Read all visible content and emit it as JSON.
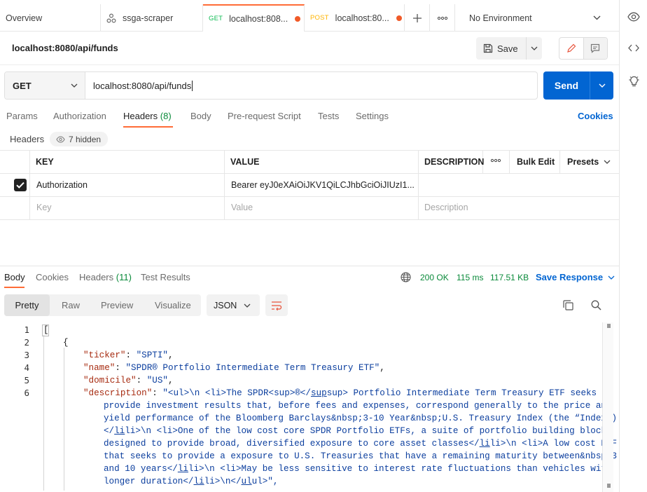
{
  "tabs": [
    {
      "label": "Overview"
    },
    {
      "label": "ssga-scraper",
      "icon": "collection-icon"
    },
    {
      "method": "GET",
      "label": "localhost:808...",
      "unsaved": true
    },
    {
      "method": "POST",
      "label": "localhost:80...",
      "unsaved": true
    }
  ],
  "environment": {
    "label": "No Environment"
  },
  "request": {
    "title": "localhost:8080/api/funds",
    "save_label": "Save",
    "method": "GET",
    "url": "localhost:8080/api/funds",
    "send_label": "Send"
  },
  "request_tabs": {
    "params": "Params",
    "authorization": "Authorization",
    "headers": "Headers",
    "headers_count": "(8)",
    "body": "Body",
    "prerequest": "Pre-request Script",
    "tests": "Tests",
    "settings": "Settings",
    "cookies": "Cookies"
  },
  "headers_section": {
    "label": "Headers",
    "hidden": "7 hidden"
  },
  "headers_table": {
    "col_key": "KEY",
    "col_value": "VALUE",
    "col_description": "DESCRIPTION",
    "bulk_edit": "Bulk Edit",
    "presets": "Presets",
    "rows": [
      {
        "key": "Authorization",
        "value": "Bearer eyJ0eXAiOiJKV1QiLCJhbGciOiJIUzI1...",
        "checked": true
      }
    ],
    "placeholder": {
      "key": "Key",
      "value": "Value",
      "description": "Description"
    }
  },
  "response_tabs": {
    "body": "Body",
    "cookies": "Cookies",
    "headers": "Headers",
    "headers_count": "(11)",
    "test_results": "Test Results"
  },
  "response_meta": {
    "status": "200 OK",
    "time": "115 ms",
    "size": "117.51 KB",
    "save_response": "Save Response"
  },
  "view_modes": {
    "pretty": "Pretty",
    "raw": "Raw",
    "preview": "Preview",
    "visualize": "Visualize",
    "format": "JSON"
  },
  "code": {
    "line_numbers": [
      "1",
      "2",
      "3",
      "4",
      "5",
      "6"
    ],
    "l1": "[",
    "l2": "{",
    "ticker_key": "\"ticker\"",
    "ticker_val": "\"SPTI\"",
    "name_key": "\"name\"",
    "name_val": "\"SPDR® Portfolio Intermediate Term Treasury ETF\"",
    "domicile_key": "\"domicile\"",
    "domicile_val": "\"US\"",
    "desc_key": "\"description\"",
    "desc_lines": [
      "\"<ul>\\n <li>The SPDR<sup>®</",
      "provide investment results that, before fees and expenses, correspond generally to the price and",
      "yield performance of the Bloomberg Barclays&nbsp;3-10 Year&nbsp;U.S. Treasury Index (the “Index”)",
      "</",
      "designed to provide broad, diversified exposure to core asset classes</",
      "that seeks to provide a exposure to U.S. Treasuries that have a remaining maturity between&nbsp;3",
      "and 10 years</",
      "longer duration</"
    ],
    "desc_tail": [
      "sup> Portfolio Intermediate Term Treasury ETF seeks to",
      "li>\\n <li>One of the low cost core SPDR Portfolio ETFs, a suite of portfolio building blocks",
      "li>\\n <li>A low cost ETF",
      "li>\\n <li>May be less sensitive to interest rate fluctuations than vehicles with",
      "li>\\n</",
      "ul>\","
    ],
    "under_sup": "sup",
    "under_li": "li",
    "under_ul": "ul"
  },
  "colors": {
    "accent": "#ff6c37",
    "send_blue": "#0265d2",
    "link_blue": "#0265d2",
    "status_green": "#0a8a3a"
  }
}
